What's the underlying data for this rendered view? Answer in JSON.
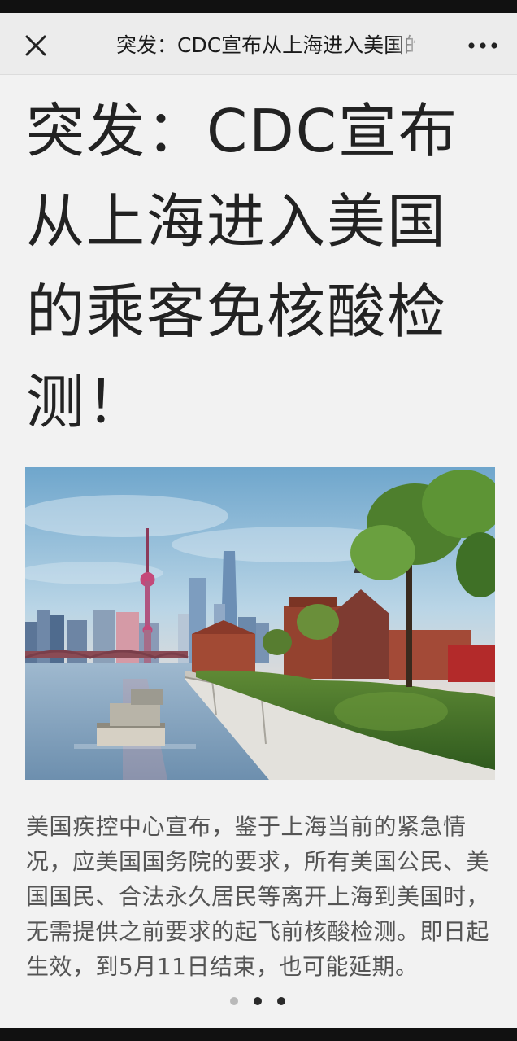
{
  "nav": {
    "close_icon": "close-icon",
    "title": "突发：CDC宣布从上海进入美国的乘客免核酸检测！",
    "more_icon": "more-dots-icon"
  },
  "article": {
    "headline": "突发：CDC宣布从上海进入美国的乘客免核酸检测！",
    "image_subject": "shanghai-skyline-photo",
    "body": "美国疾控中心宣布，鉴于上海当前的紧急情况，应美国国务院的要求，所有美国公民、美国国民、合法永久居民等离开上海到美国时，无需提供之前要求的起飞前核酸检测。即日起生效，到5月11日结束，也可能延期。"
  },
  "pager": {
    "count": 3,
    "active": 1
  },
  "colors": {
    "background": "#f2f2f2",
    "nav_background": "#ececec",
    "headline": "#222222",
    "body_text": "#555555"
  }
}
